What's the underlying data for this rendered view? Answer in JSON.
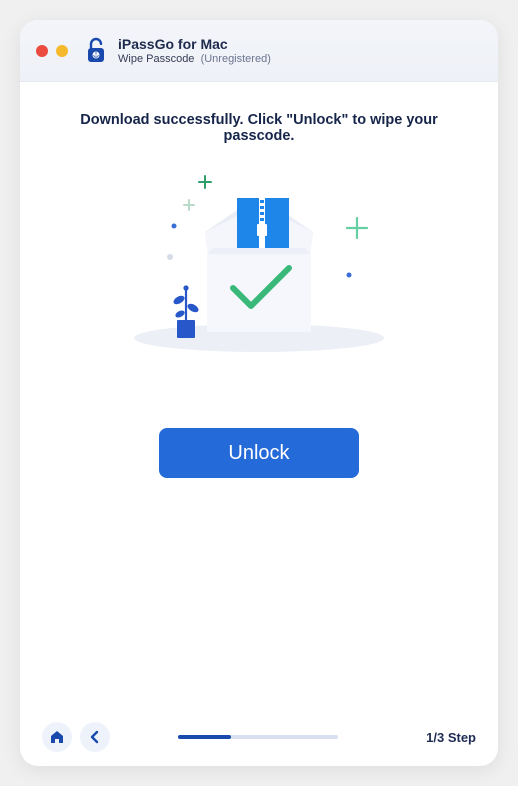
{
  "app": {
    "title": "iPassGo for Mac",
    "subtitle_mode": "Wipe Passcode",
    "subtitle_reg": "(Unregistered)"
  },
  "main": {
    "message": "Download successfully. Click \"Unlock\" to wipe your passcode.",
    "unlock_label": "Unlock"
  },
  "footer": {
    "step_label": "1/3 Step",
    "progress_percent": 33
  }
}
